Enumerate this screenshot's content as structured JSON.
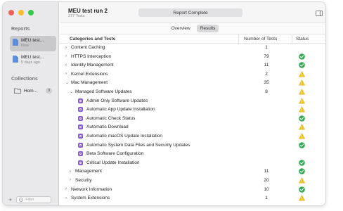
{
  "sidebar": {
    "reports_heading": "Reports",
    "reports": [
      {
        "title": "MEU test...",
        "subtitle": "Now"
      },
      {
        "title": "MEU test...",
        "subtitle": "5 days ago"
      }
    ],
    "collections_heading": "Collections",
    "collections": [
      {
        "label": "Hom...",
        "count": "0"
      }
    ],
    "add_label": "+",
    "filter_placeholder": "Filter"
  },
  "header": {
    "title": "MEU test run 2",
    "subtitle": "277 Tests",
    "status": "Report Complete"
  },
  "tabs": [
    "Overview",
    "Results"
  ],
  "active_tab": "Results",
  "table": {
    "columns": [
      "Categories and Tests",
      "Number of Tests",
      "Status"
    ],
    "rows": [
      {
        "name": "Content Caching",
        "count": "1",
        "status": "none",
        "level": 0,
        "chevron": "›"
      },
      {
        "name": "HTTPS Interception",
        "count": "79",
        "status": "pass",
        "level": 0,
        "chevron": "›"
      },
      {
        "name": "Identity Management",
        "count": "11",
        "status": "pass",
        "level": 0,
        "chevron": "›"
      },
      {
        "name": "Kernel Extensions",
        "count": "2",
        "status": "warn",
        "level": 0,
        "chevron": "›"
      },
      {
        "name": "Mac Management",
        "count": "35",
        "status": "warn",
        "level": 0,
        "chevron": "⌄"
      },
      {
        "name": "Managed Software Updates",
        "count": "8",
        "status": "warn",
        "level": 1,
        "chevron": "⌄"
      },
      {
        "name": "Admin Only Software Updates",
        "count": "",
        "status": "warn",
        "level": 2,
        "chevron": ""
      },
      {
        "name": "Automatic App Update Installation",
        "count": "",
        "status": "warn",
        "level": 2,
        "chevron": ""
      },
      {
        "name": "Automatic Check Status",
        "count": "",
        "status": "pass",
        "level": 2,
        "chevron": ""
      },
      {
        "name": "Automatic Download",
        "count": "",
        "status": "warn",
        "level": 2,
        "chevron": ""
      },
      {
        "name": "Automatic macOS Update Installation",
        "count": "",
        "status": "warn",
        "level": 2,
        "chevron": ""
      },
      {
        "name": "Automatic System Data Files and Security Updates",
        "count": "",
        "status": "pass",
        "level": 2,
        "chevron": ""
      },
      {
        "name": "Beta Software Configuration",
        "count": "",
        "status": "none",
        "level": 2,
        "chevron": ""
      },
      {
        "name": "Critical Update Installation",
        "count": "",
        "status": "pass",
        "level": 2,
        "chevron": ""
      },
      {
        "name": "Management",
        "count": "11",
        "status": "pass",
        "level": 1,
        "chevron": "›"
      },
      {
        "name": "Security",
        "count": "20",
        "status": "warn",
        "level": 1,
        "chevron": "›"
      },
      {
        "name": "Network Information",
        "count": "10",
        "status": "pass",
        "level": 0,
        "chevron": "›"
      },
      {
        "name": "System Extensions",
        "count": "1",
        "status": "warn",
        "level": 0,
        "chevron": "›"
      }
    ]
  },
  "colors": {
    "pass": "#35a853",
    "warn": "#f2c12e",
    "test_icon": "#8a5cd6"
  }
}
